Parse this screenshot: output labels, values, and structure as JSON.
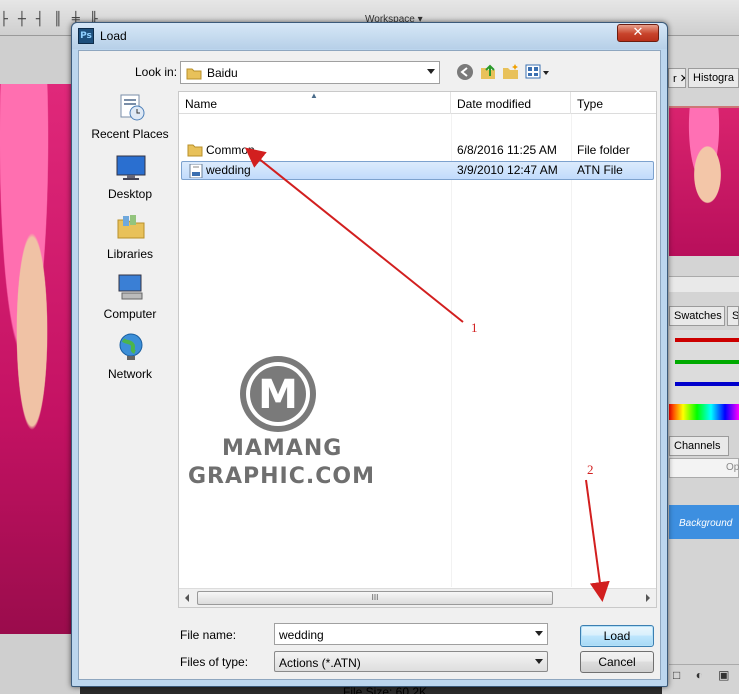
{
  "dialog": {
    "title": "Load",
    "close_glyph": "✕",
    "look_in_label": "Look in:",
    "look_in_value": "Baidu",
    "places": [
      "Recent Places",
      "Desktop",
      "Libraries",
      "Computer",
      "Network"
    ],
    "columns": {
      "name": "Name",
      "date": "Date modified",
      "type": "Type"
    },
    "files": [
      {
        "name": "Common",
        "date": "6/8/2016 11:25 AM",
        "type": "File folder",
        "icon": "folder-icon"
      },
      {
        "name": "wedding",
        "date": "3/9/2010 12:47 AM",
        "type": "ATN File",
        "icon": "atn-file-icon",
        "selected": true
      }
    ],
    "file_name_label": "File name:",
    "file_name_value": "wedding",
    "file_type_label": "Files of type:",
    "file_type_value": "Actions (*.ATN)",
    "load_label": "Load",
    "cancel_label": "Cancel",
    "file_size": "File Size: 60.2K",
    "scroll_grip": "III"
  },
  "photoshop": {
    "workspace_label": "Workspace ▾",
    "tab_histogram": "Histogra",
    "tab_swatches": "Swatches",
    "tab_swatches_next": "S",
    "tab_channels": "Channels",
    "opacity_label": "Op",
    "layer_name": "Background"
  },
  "watermark": {
    "line1": "MAMANG",
    "line2": "GRAPHIC.COM",
    "logo_letter": "M"
  },
  "annotations": {
    "marker1": "1",
    "marker2": "2",
    "color": "#d21f1f"
  }
}
